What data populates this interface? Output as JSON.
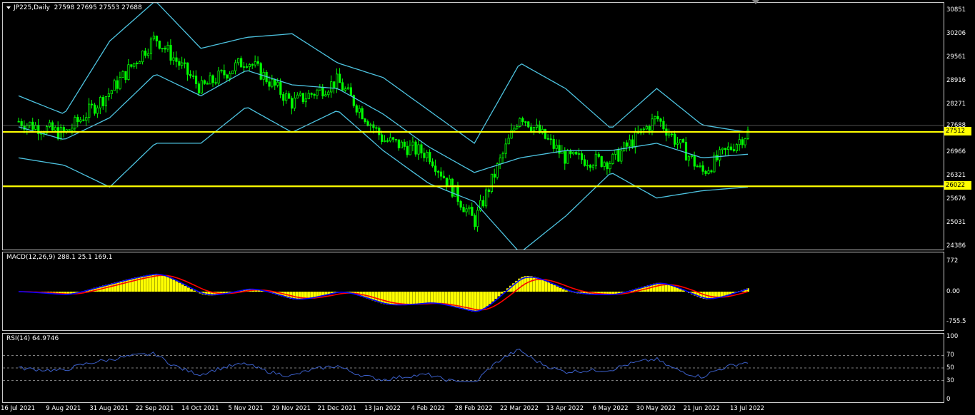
{
  "main": {
    "symbol_label": "JP225,Daily",
    "ohlc": "27598 27695 27553 27688",
    "price_ticks": [
      "30851",
      "30206",
      "29561",
      "28916",
      "28271",
      "27688",
      "26966",
      "26321",
      "25676",
      "25031",
      "24386"
    ],
    "tick_values": [
      30851,
      30206,
      29561,
      28916,
      28271,
      27688,
      26966,
      26321,
      25676,
      25031,
      24386
    ],
    "hlines": [
      {
        "value": 27512,
        "label": "27512",
        "color": "#ffff00"
      },
      {
        "value": 26022,
        "label": "26022",
        "color": "#ffff00"
      }
    ],
    "current_price": {
      "value": 27688,
      "label": "27688"
    },
    "colors": {
      "candle": "#00ff00",
      "bands": "#4dc3e0",
      "hline": "#ffff00",
      "frame": "#c8c8c8"
    },
    "ylim": [
      24386,
      31150
    ]
  },
  "macd": {
    "label": "MACD(12,26,9) 288.1 25.1 169.1",
    "ticks": [
      "772",
      "0.00",
      "-755.5"
    ],
    "ylim": [
      -860,
      880
    ],
    "colors": {
      "histogram": "#ffff00",
      "macd_line": "#0000ff",
      "signal_line": "#ff0000"
    }
  },
  "rsi": {
    "label": "RSI(14) 64.9746",
    "ticks": [
      "100",
      "70",
      "50",
      "30",
      "0"
    ],
    "levels": [
      70,
      50,
      30
    ],
    "colors": {
      "line": "#3b5fc9",
      "level": "#aaaaaa"
    }
  },
  "x_axis": {
    "labels": [
      "16 Jul 2021",
      "9 Aug 2021",
      "31 Aug 2021",
      "22 Sep 2021",
      "14 Oct 2021",
      "5 Nov 2021",
      "29 Nov 2021",
      "21 Dec 2021",
      "13 Jan 2022",
      "4 Feb 2022",
      "28 Feb 2022",
      "22 Mar 2022",
      "13 Apr 2022",
      "6 May 2022",
      "30 May 2022",
      "21 Jun 2022",
      "13 Jul 2022"
    ]
  },
  "chart_data": {
    "type": "line",
    "x": [
      "16 Jul 2021",
      "9 Aug 2021",
      "31 Aug 2021",
      "22 Sep 2021",
      "14 Oct 2021",
      "5 Nov 2021",
      "29 Nov 2021",
      "21 Dec 2021",
      "13 Jan 2022",
      "4 Feb 2022",
      "28 Feb 2022",
      "22 Mar 2022",
      "13 Apr 2022",
      "6 May 2022",
      "30 May 2022",
      "21 Jun 2022",
      "13 Jul 2022"
    ],
    "series": [
      {
        "values": [
          27800,
          27450,
          28600,
          30100,
          28700,
          29500,
          28300,
          28900,
          27300,
          26900,
          25050,
          28000,
          26800,
          26700,
          27900,
          26400,
          27500
        ]
      },
      {
        "values": [
          27650,
          27300,
          27900,
          29100,
          28500,
          29200,
          28800,
          28700,
          28000,
          27100,
          26400,
          26800,
          27000,
          27000,
          27200,
          26800,
          26900
        ]
      },
      {
        "values": [
          28500,
          28000,
          30000,
          31100,
          29800,
          30100,
          30200,
          29400,
          29000,
          28100,
          27200,
          29400,
          28700,
          27600,
          28700,
          27700,
          27500
        ]
      },
      {
        "values": [
          26800,
          26600,
          26000,
          27200,
          27200,
          28200,
          27500,
          28100,
          27000,
          26100,
          25600,
          24200,
          25200,
          26400,
          25700,
          25900,
          26000
        ]
      }
    ],
    "ylim": [
      24386,
      31150
    ]
  }
}
